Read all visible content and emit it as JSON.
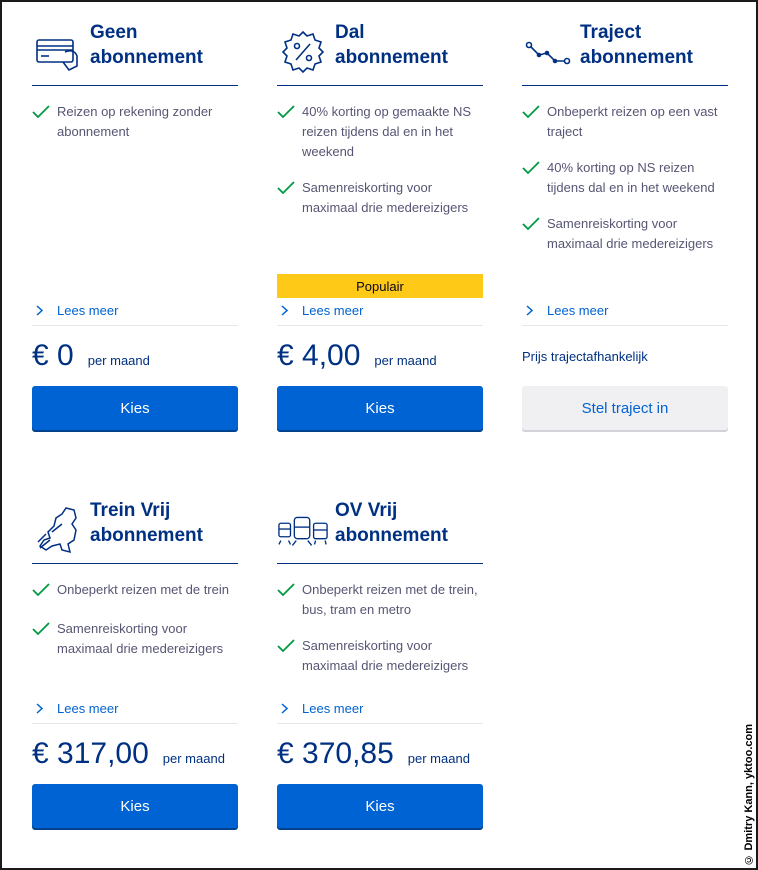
{
  "cards": [
    {
      "title_line1": "Geen",
      "title_line2": "abonnement",
      "icon": "card-hand-icon",
      "features": [
        "Reizen op rekening zonder abonnement"
      ],
      "badge": "",
      "more": "Lees meer",
      "price": "€ 0",
      "per": "per maand",
      "note": "",
      "button": "Kies",
      "button_style": "primary"
    },
    {
      "title_line1": "Dal",
      "title_line2": "abonnement",
      "icon": "percent-icon",
      "features": [
        "40% korting op gemaakte NS reizen tijdens dal en in het weekend",
        "Samenreiskorting voor maximaal drie medereizigers"
      ],
      "badge": "Populair",
      "more": "Lees meer",
      "price": "€ 4,00",
      "per": "per maand",
      "note": "",
      "button": "Kies",
      "button_style": "primary"
    },
    {
      "title_line1": "Traject",
      "title_line2": "abonnement",
      "icon": "route-icon",
      "features": [
        "Onbeperkt reizen op een vast traject",
        "40% korting op NS reizen tijdens dal en in het weekend",
        "Samenreiskorting voor maximaal drie medereizigers"
      ],
      "badge": "",
      "more": "Lees meer",
      "price": "",
      "per": "",
      "note": "Prijs trajectafhankelijk",
      "button": "Stel traject in",
      "button_style": "secondary"
    },
    {
      "title_line1": "Trein Vrij",
      "title_line2": "abonnement",
      "icon": "netherlands-map-icon",
      "features": [
        "Onbeperkt reizen met de trein",
        "Samenreiskorting voor maximaal drie medereizigers"
      ],
      "badge": "",
      "more": "Lees meer",
      "price": "€ 317,00",
      "per": "per maand",
      "note": "",
      "button": "Kies",
      "button_style": "primary"
    },
    {
      "title_line1": "OV Vrij",
      "title_line2": "abonnement",
      "icon": "public-transport-icon",
      "features": [
        "Onbeperkt reizen met de trein, bus, tram en metro",
        "Samenreiskorting voor maximaal drie medereizigers"
      ],
      "badge": "",
      "more": "Lees meer",
      "price": "€ 370,85",
      "per": "per maand",
      "note": "",
      "button": "Kies",
      "button_style": "primary"
    }
  ],
  "credit": "© Dmitry Kann, yktoo.com",
  "colors": {
    "ns_blue": "#003082",
    "action_blue": "#0063d3",
    "check_green": "#009a42",
    "yellow": "#ffc917"
  }
}
